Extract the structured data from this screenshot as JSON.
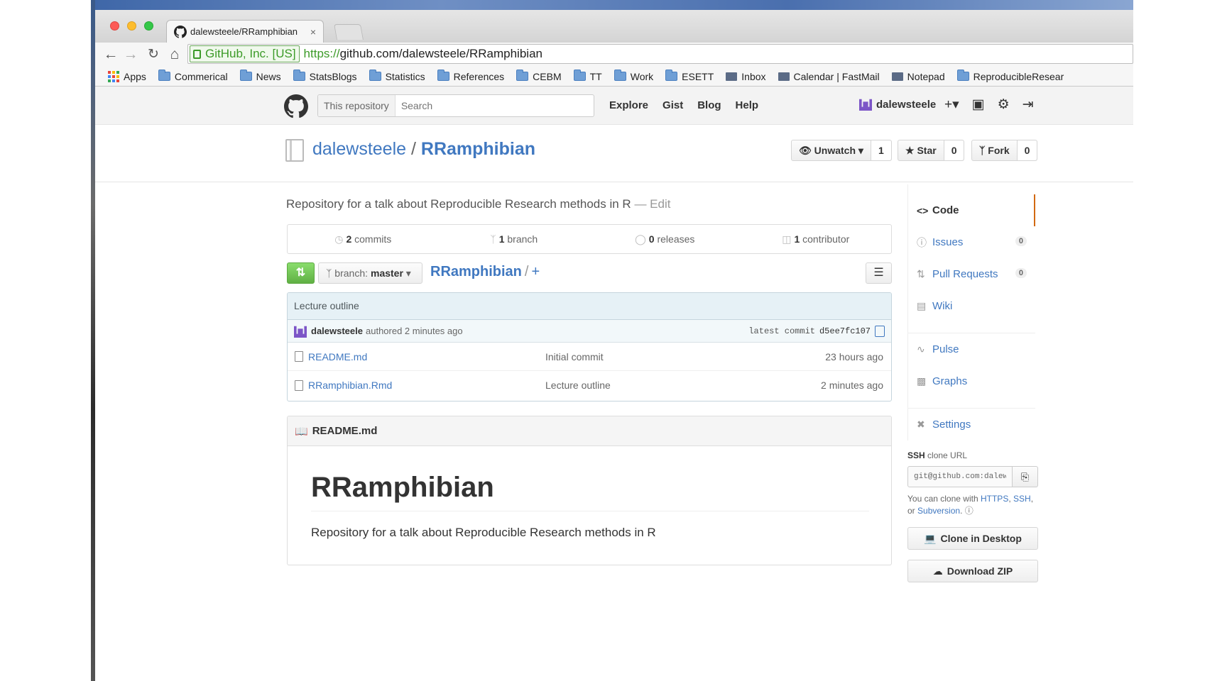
{
  "browser": {
    "tab_title": "dalewsteele/RRamphibian",
    "tab_close": "×",
    "ev_label": "GitHub, Inc. [US]",
    "url_scheme": "https://",
    "url_host": "github.com",
    "url_path": "/dalewsteele/RRamphibian",
    "bookmarks": [
      "Apps",
      "Commerical",
      "News",
      "StatsBlogs",
      "Statistics",
      "References",
      "CEBM",
      "TT",
      "Work",
      "ESETT",
      "Inbox",
      "Calendar | FastMail",
      "Notepad",
      "ReproducibleResear"
    ]
  },
  "github": {
    "scope_label": "This repository",
    "search_placeholder": "Search",
    "nav": [
      "Explore",
      "Gist",
      "Blog",
      "Help"
    ],
    "username": "dalewsteele",
    "owner": "dalewsteele",
    "separator": "/",
    "repo": "RRamphibian",
    "watch": {
      "label": "Unwatch",
      "count": "1"
    },
    "star": {
      "label": "Star",
      "count": "0"
    },
    "fork": {
      "label": "Fork",
      "count": "0"
    },
    "description": "Repository for a talk about Reproducible Research methods in R",
    "edit": "— Edit",
    "summary": {
      "commits_num": "2",
      "commits_label": "commits",
      "branch_num": "1",
      "branch_label": "branch",
      "releases_num": "0",
      "releases_label": "releases",
      "contributor_num": "1",
      "contributor_label": "contributor"
    },
    "branch_prefix": "branch:",
    "branch_name": "master",
    "breadcrumb_root": "RRamphibian",
    "breadcrumb_sep": "/",
    "breadcrumb_add": "+",
    "commit_title": "Lecture outline",
    "commit_author": "dalewsteele",
    "commit_when": "authored 2 minutes ago",
    "commit_latest_label": "latest commit",
    "commit_sha": "d5ee7fc107",
    "files": [
      {
        "name": "README.md",
        "message": "Initial commit",
        "age": "23 hours ago"
      },
      {
        "name": "RRamphibian.Rmd",
        "message": "Lecture outline",
        "age": "2 minutes ago"
      }
    ],
    "readme_file": "README.md",
    "readme_heading": "RRamphibian",
    "readme_text": "Repository for a talk about Reproducible Research methods in R"
  },
  "sidebar": {
    "nav": [
      {
        "label": "Code",
        "icon": "code-icon"
      },
      {
        "label": "Issues",
        "icon": "issue-icon",
        "count": "0"
      },
      {
        "label": "Pull Requests",
        "icon": "pull-request-icon",
        "count": "0"
      },
      {
        "label": "Wiki",
        "icon": "book-icon"
      },
      {
        "label": "Pulse",
        "icon": "pulse-icon"
      },
      {
        "label": "Graphs",
        "icon": "graph-icon"
      },
      {
        "label": "Settings",
        "icon": "tools-icon"
      }
    ],
    "clone_protocol": "SSH",
    "clone_label": "clone URL",
    "clone_url": "git@github.com:dalewsteele/RRamphibian.git",
    "clone_help_prefix": "You can clone with",
    "clone_https": "HTTPS",
    "clone_ssh": "SSH",
    "clone_or": "or",
    "clone_subversion": "Subversion",
    "clone_desktop": "Clone in Desktop",
    "download_zip": "Download ZIP"
  },
  "colors": {
    "link": "#4078c0",
    "accent": "#d26911",
    "compare_green": "#6cc644"
  }
}
